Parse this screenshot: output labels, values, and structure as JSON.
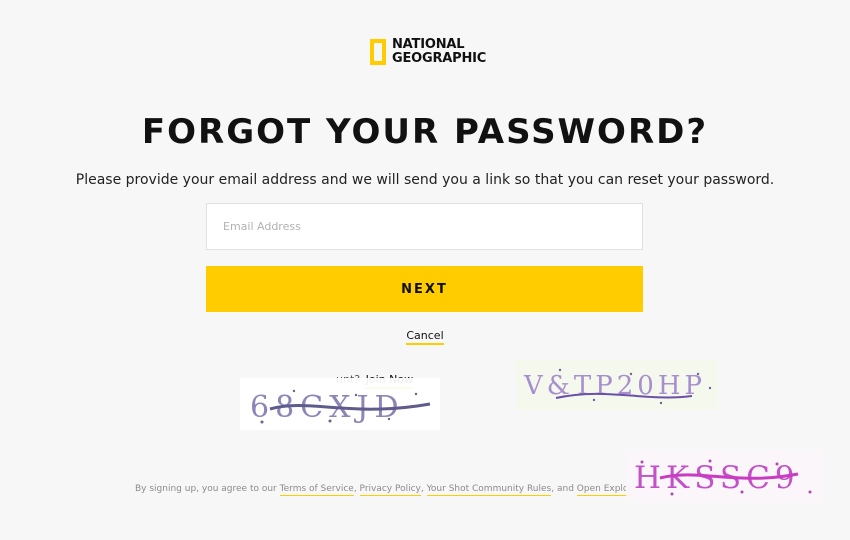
{
  "brand": {
    "line1": "NATIONAL",
    "line2": "GEOGRAPHIC",
    "accent_color": "#ffcc00"
  },
  "page": {
    "title": "FORGOT YOUR PASSWORD?",
    "subtitle": "Please provide your email address and we will send you a link so that you can reset your password."
  },
  "form": {
    "email_placeholder": "Email Address",
    "email_value": "",
    "next_label": "NEXT",
    "cancel_label": "Cancel"
  },
  "join": {
    "visible_text": "unt?",
    "link_label": "Join Now"
  },
  "legal": {
    "prefix": "By signing up, you agree to our",
    "terms": "Terms of Service",
    "privacy": "Privacy Policy",
    "community": "Your Shot Community Rules",
    "and_text": "and",
    "open_explore": "Open Explor"
  },
  "captchas": [
    {
      "text": "68CXJD"
    },
    {
      "text": "V&TP20HP"
    },
    {
      "text": "HKSSC9"
    }
  ]
}
